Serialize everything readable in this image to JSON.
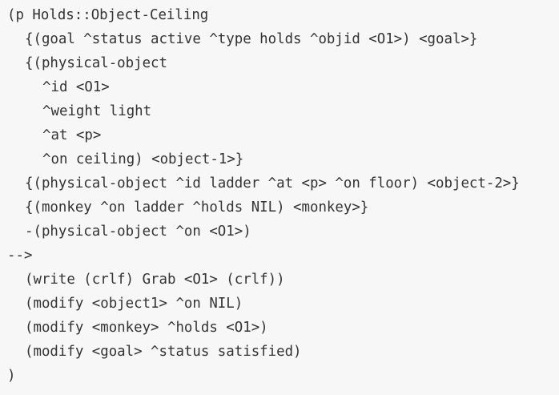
{
  "code": {
    "lines": [
      "(p Holds::Object-Ceiling",
      "{(goal ^status active ^type holds ^objid <O1>) <goal>}",
      "{(physical-object",
      "^id <O1>",
      "^weight light",
      "^at <p>",
      "^on ceiling) <object-1>}",
      "{(physical-object ^id ladder ^at <p> ^on floor) <object-2>}",
      "{(monkey ^on ladder ^holds NIL) <monkey>}",
      "-(physical-object ^on <O1>)",
      "-->",
      "(write (crlf) Grab <O1> (crlf))",
      "(modify <object1> ^on NIL)",
      "(modify <monkey> ^holds <O1>)",
      "(modify <goal> ^status satisfied)",
      ")"
    ]
  },
  "colors": {
    "background": "#f7f7f7",
    "text": "#333333"
  }
}
